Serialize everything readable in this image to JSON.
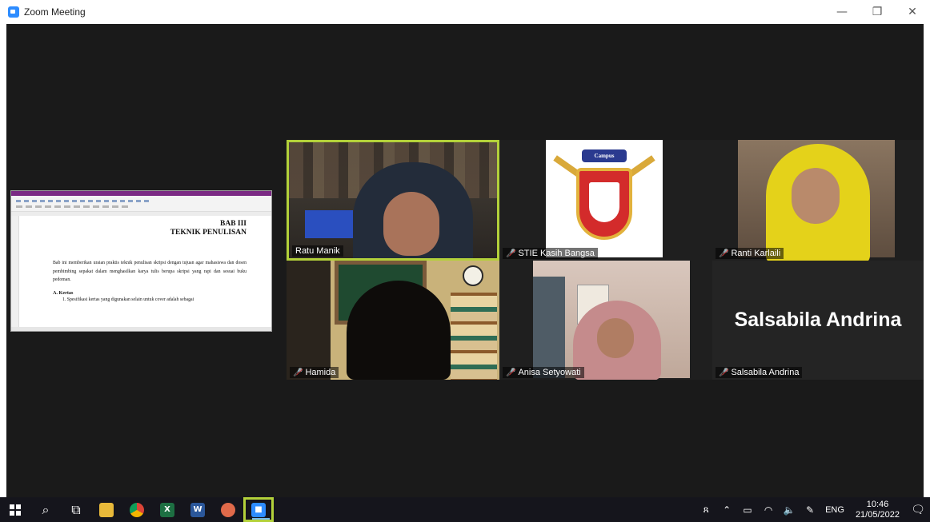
{
  "window": {
    "title": "Zoom Meeting",
    "minimize": "—",
    "restore": "❐",
    "close": "✕"
  },
  "shared_screen": {
    "chapter": "BAB III",
    "chapter_title": "TEKNIK PENULISAN",
    "paragraph": "Bab ini memberikan uraian praktis teknik penulisan skripsi dengan tujuan agar mahasiswa dan dosen pembimbing sepakat dalam menghasilkan karya tulis berupa skripsi yang rapi dan sesuai buku pedoman.",
    "section": "A.  Kertas",
    "item": "1.   Spesifikasi kertas yang digunakan selain untuk cover adalah sebagai"
  },
  "participants": [
    {
      "name": "Ratu Manik",
      "muted": false,
      "active_speaker": true
    },
    {
      "name": "STIE Kasih Bangsa",
      "muted": true,
      "active_speaker": false
    },
    {
      "name": "Ranti Karlaili",
      "muted": true,
      "active_speaker": false
    },
    {
      "name": "Hamida",
      "muted": true,
      "active_speaker": false
    },
    {
      "name": "Anisa Setyowati",
      "muted": true,
      "active_speaker": false
    },
    {
      "name": "Salsabila Andrina",
      "muted": true,
      "active_speaker": false,
      "video_off": true
    }
  ],
  "logo": {
    "banner": "Campus"
  },
  "taskbar": {
    "search_icon": "⌕",
    "task_view_icon": "⧉",
    "language": "ENG",
    "time": "10:46",
    "date": "21/05/2022"
  }
}
